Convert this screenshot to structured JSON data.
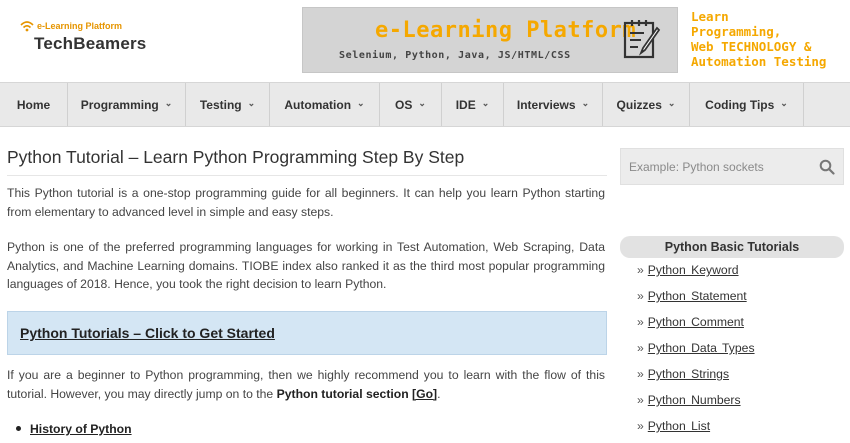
{
  "logo": {
    "tagline": "e-Learning Platform",
    "name": "TechBeamers"
  },
  "banner": {
    "title": "e-Learning Platform",
    "subtitle": "Selenium, Python, Java, JS/HTML/CSS",
    "icon": "checklist-pencil-icon",
    "side_text": [
      "Learn",
      "Programming,",
      "Web TECHNOLOGY &",
      "Automation Testing"
    ],
    "accent_color": "#f5a800"
  },
  "nav": {
    "items": [
      {
        "label": "Home",
        "has_dropdown": false
      },
      {
        "label": "Programming",
        "has_dropdown": true
      },
      {
        "label": "Testing",
        "has_dropdown": true
      },
      {
        "label": "Automation",
        "has_dropdown": true
      },
      {
        "label": "OS",
        "has_dropdown": true
      },
      {
        "label": "IDE",
        "has_dropdown": true
      },
      {
        "label": "Interviews",
        "has_dropdown": true
      },
      {
        "label": "Quizzes",
        "has_dropdown": true
      },
      {
        "label": "Coding Tips",
        "has_dropdown": true
      }
    ],
    "chevron_icon": "chevron-down-icon"
  },
  "article": {
    "title": "Python Tutorial – Learn Python Programming Step By Step",
    "para1": "This Python tutorial is a one-stop programming guide for all beginners. It can help you learn Python starting from elementary to advanced level in simple and easy steps.",
    "para2": "Python is one of the preferred programming languages for working in Test Automation, Web Scraping, Data Analytics, and Machine Learning domains. TIOBE index also ranked it as the third most popular programming languages of 2018. Hence, you took the right decision to learn Python.",
    "callout_link": "Python Tutorials – Click to Get Started",
    "para3_before": "If you are a beginner to Python programming, then we highly recommend you to learn with the flow of this tutorial. However, you may directly jump on to the ",
    "para3_bold": "Python tutorial section ",
    "para3_go": "[Go]",
    "para3_after": ".",
    "bullets": [
      "History of Python"
    ]
  },
  "sidebar": {
    "search_placeholder": "Example: Python sockets",
    "search_icon": "search-icon",
    "heading": "Python Basic Tutorials",
    "links": [
      "Python Keyword",
      "Python Statement",
      "Python Comment",
      "Python Data Types",
      "Python Strings",
      "Python Numbers",
      "Python List"
    ]
  }
}
